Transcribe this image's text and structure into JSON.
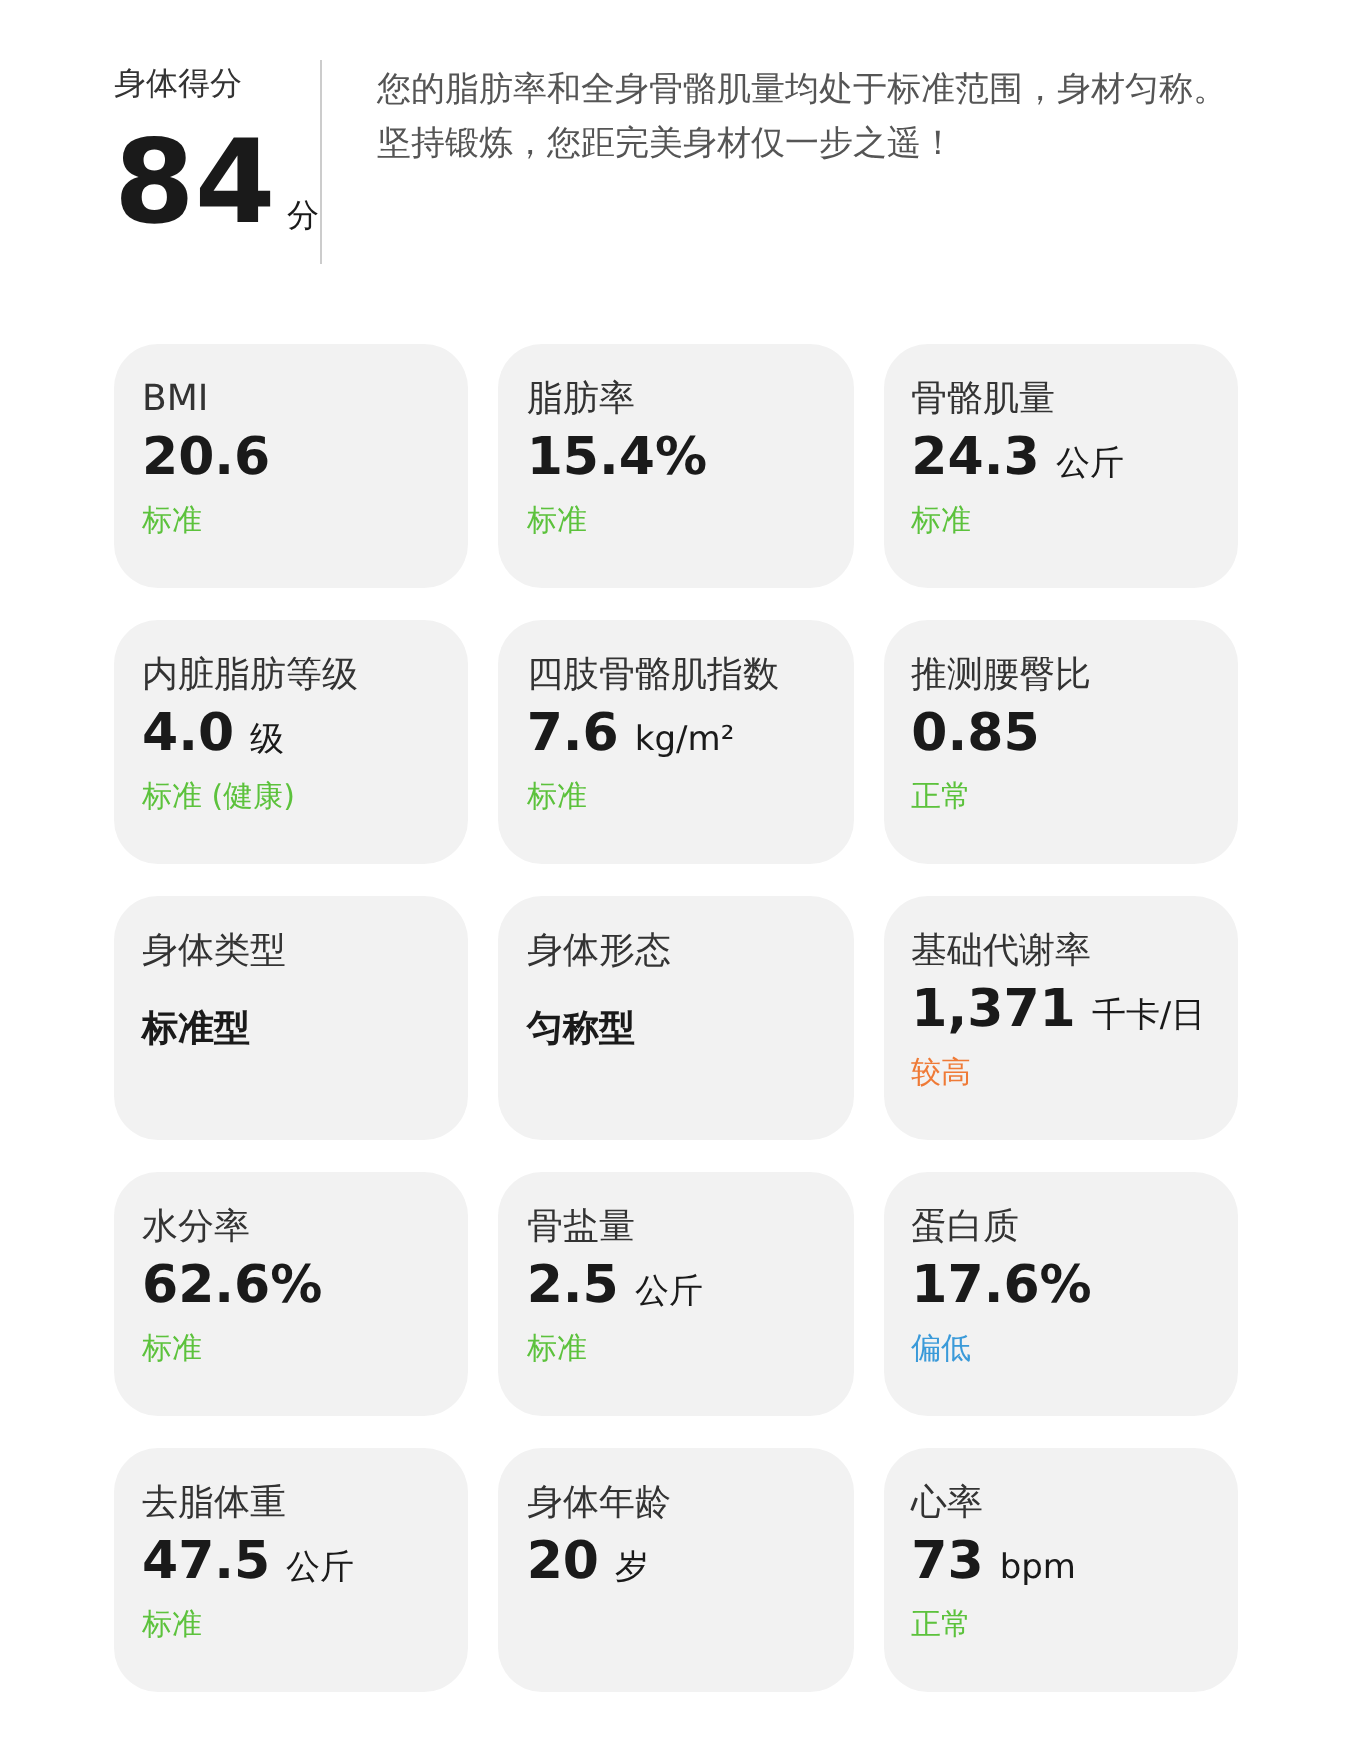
{
  "score": {
    "label": "身体得分",
    "value": "84",
    "unit": "分"
  },
  "summary": "您的脂肪率和全身骨骼肌量均处于标准范围，身材匀称。坚持锻炼，您距完美身材仅一步之遥！",
  "metrics": [
    {
      "kind": "metric",
      "label": "BMI",
      "value": "20.6",
      "status": "标准",
      "color": "#5cc23c"
    },
    {
      "kind": "metric",
      "label": "脂肪率",
      "value": "15.4%",
      "status": "标准",
      "color": "#5cc23c"
    },
    {
      "kind": "metric",
      "label": "骨骼肌量",
      "value": "24.3",
      "unit": "公斤",
      "status": "标准",
      "color": "#5cc23c"
    },
    {
      "kind": "metric",
      "label": "内脏脂肪等级",
      "value": "4.0",
      "unit": "级",
      "status": "标准 (健康)",
      "color": "#5cc23c"
    },
    {
      "kind": "metric",
      "label": "四肢骨骼肌指数",
      "value": "7.6",
      "unit": "kg/m²",
      "status": "标准",
      "color": "#5cc23c"
    },
    {
      "kind": "metric",
      "label": "推测腰臀比",
      "value": "0.85",
      "status": "正常",
      "color": "#5cc23c"
    },
    {
      "kind": "type",
      "label": "身体类型",
      "value": "标准型"
    },
    {
      "kind": "type",
      "label": "身体形态",
      "value": "匀称型"
    },
    {
      "kind": "metric",
      "label": "基础代谢率",
      "value": "1,371",
      "unit": "千卡/日",
      "status": "较高",
      "color": "#ef7a36"
    },
    {
      "kind": "metric",
      "label": "水分率",
      "value": "62.6%",
      "status": "标准",
      "color": "#5cc23c"
    },
    {
      "kind": "metric",
      "label": "骨盐量",
      "value": "2.5",
      "unit": "公斤",
      "status": "标准",
      "color": "#5cc23c"
    },
    {
      "kind": "metric",
      "label": "蛋白质",
      "value": "17.6%",
      "status": "偏低",
      "color": "#3a9ad9"
    },
    {
      "kind": "metric",
      "label": "去脂体重",
      "value": "47.5",
      "unit": "公斤",
      "status": "标准",
      "color": "#5cc23c"
    },
    {
      "kind": "metric",
      "label": "身体年龄",
      "value": "20",
      "unit": "岁"
    },
    {
      "kind": "metric",
      "label": "心率",
      "value": "73",
      "unit": "bpm",
      "status": "正常",
      "color": "#5cc23c"
    }
  ]
}
